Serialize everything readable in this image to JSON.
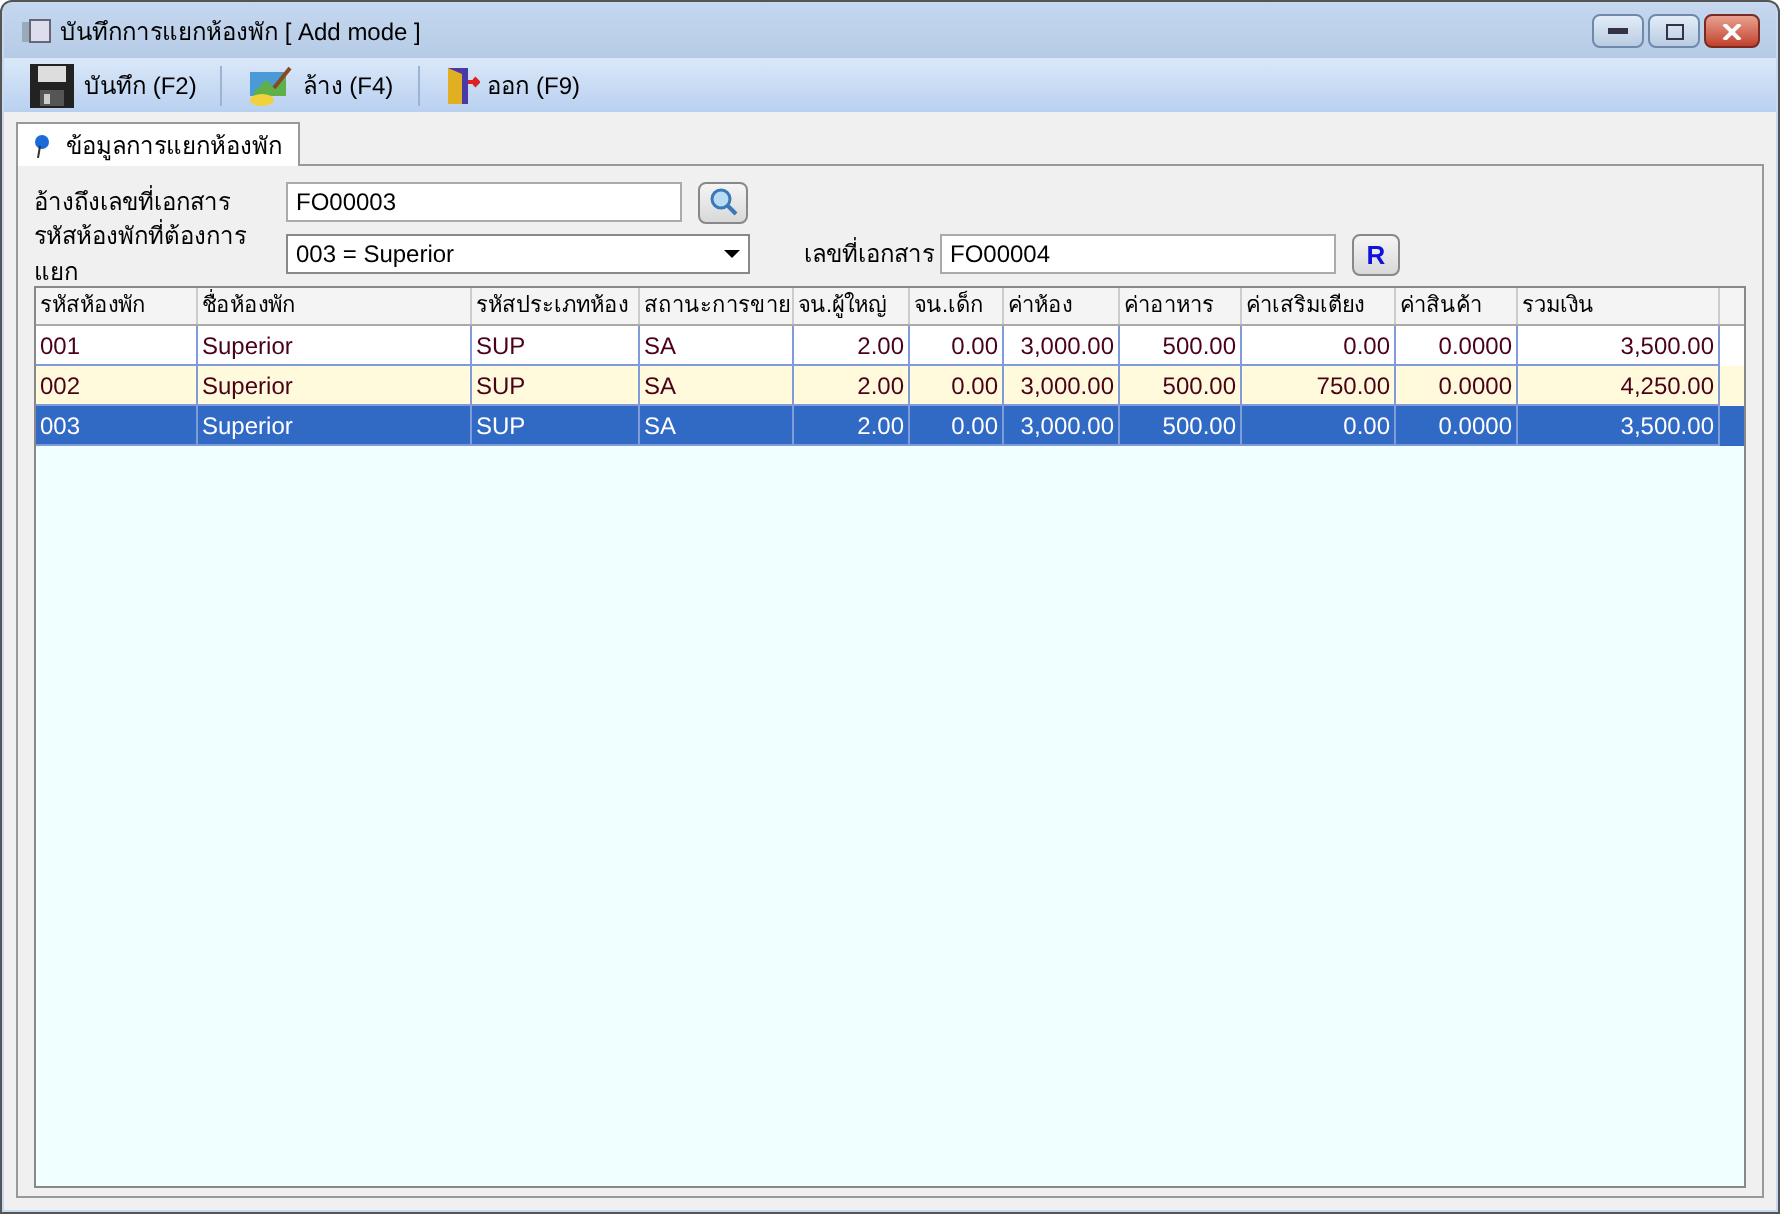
{
  "window": {
    "title": "บันทึกการแยกห้องพัก [ Add mode ]"
  },
  "toolbar": [
    {
      "label": "บันทึก (F2)",
      "kind": "save"
    },
    {
      "label": "ล้าง (F4)",
      "kind": "clear"
    },
    {
      "label": "ออก (F9)",
      "kind": "exit"
    }
  ],
  "tabs": [
    {
      "label": "ข้อมูลการแยกห้องพัก",
      "selected": true
    }
  ],
  "form": {
    "ref_label": "อ้างถึงเลขที่เอกสาร",
    "ref_value": "FO00003",
    "room_label": "รหัสห้องพักที่ต้องการแยก",
    "room_value": "003 = Superior",
    "doc_label": "เลขที่เอกสาร",
    "doc_value": "FO00004",
    "r_button": "R"
  },
  "table": {
    "columns": [
      "รหัสห้องพัก",
      "ชื่อห้องพัก",
      "รหัสประเภทห้อง",
      "สถานะการขาย",
      "จน.ผู้ใหญ่",
      "จน.เด็ก",
      "ค่าห้อง",
      "ค่าอาหาร",
      "ค่าเสริมเตียง",
      "ค่าสินค้า",
      "รวมเงิน"
    ],
    "rows": [
      {
        "selected": false,
        "cells": [
          "001",
          "Superior",
          "SUP",
          "SA",
          "2.00",
          "0.00",
          "3,000.00",
          "500.00",
          "0.00",
          "0.0000",
          "3,500.00"
        ]
      },
      {
        "selected": false,
        "cells": [
          "002",
          "Superior",
          "SUP",
          "SA",
          "2.00",
          "0.00",
          "3,000.00",
          "500.00",
          "750.00",
          "0.0000",
          "4,250.00"
        ]
      },
      {
        "selected": true,
        "cells": [
          "003",
          "Superior",
          "SUP",
          "SA",
          "2.00",
          "0.00",
          "3,000.00",
          "500.00",
          "0.00",
          "0.0000",
          "3,500.00"
        ]
      }
    ]
  }
}
